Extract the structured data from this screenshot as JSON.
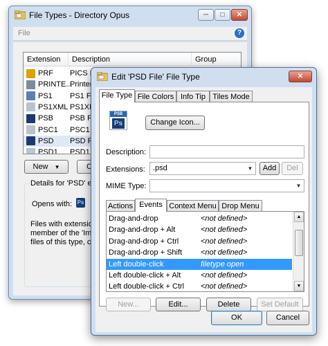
{
  "back_window": {
    "title": "File Types - Directory Opus",
    "menu": {
      "file": "File"
    },
    "list": {
      "headers": [
        "Extension",
        "Description",
        "Group"
      ],
      "rows": [
        {
          "ext": "PRF",
          "desc": "PICS R",
          "icon": "key-icon",
          "color": "#d9a400"
        },
        {
          "ext": "PRINTE...",
          "desc": "Printer",
          "icon": "printer-icon",
          "color": "#7a8ca0"
        },
        {
          "ext": "PS1",
          "desc": "PS1 Fil",
          "icon": "script-icon",
          "color": "#5e7fb0"
        },
        {
          "ext": "PS1XML",
          "desc": "PS1XM",
          "icon": "document-icon",
          "color": "#b9c4d2"
        },
        {
          "ext": "PSB",
          "desc": "PSB Fil",
          "icon": "photoshop-icon",
          "color": "#1d3a6e"
        },
        {
          "ext": "PSC1",
          "desc": "PSC1 F",
          "icon": "document-icon",
          "color": "#b9c4d2"
        },
        {
          "ext": "PSD",
          "desc": "PSD Fil",
          "icon": "photoshop-icon",
          "color": "#1d3a6e"
        },
        {
          "ext": "PSD1",
          "desc": "PSD1 Fi",
          "icon": "document-icon",
          "color": "#b9c4d2"
        }
      ]
    },
    "new_button": "New",
    "second_button_partial": "C",
    "details_label": "Details for 'PSD' ext",
    "opens_with_label": "Opens with:",
    "description_lines": [
      "Files with extension",
      "member of the 'Ima",
      "files of this type, cli"
    ]
  },
  "front_window": {
    "title": "Edit 'PSD File' File Type",
    "tabs": [
      "File Type",
      "File Colors",
      "Info Tip",
      "Tiles Mode"
    ],
    "psd_icon_label": "PSB",
    "psd_icon_glyph": "Ps",
    "change_icon_button": "Change Icon...",
    "description_label": "Description:",
    "description_value": "",
    "extensions_label": "Extensions:",
    "extensions_value": ".psd",
    "add_button": "Add",
    "del_button": "Del",
    "mime_label": "MIME Type:",
    "mime_value": "",
    "sub_tabs": [
      "Actions",
      "Events",
      "Context Menu",
      "Drop Menu"
    ],
    "events": [
      {
        "name": "Drag-and-drop",
        "value": "<not defined>"
      },
      {
        "name": "Drag-and-drop + Alt",
        "value": "<not defined>"
      },
      {
        "name": "Drag-and-drop + Ctrl",
        "value": "<not defined>"
      },
      {
        "name": "Drag-and-drop + Shift",
        "value": "<not defined>"
      },
      {
        "name": "Left double-click",
        "value": "filetype open",
        "selected": true
      },
      {
        "name": "Left double-click + Alt",
        "value": "<not defined>"
      },
      {
        "name": "Left double-click + Ctrl",
        "value": "<not defined>"
      }
    ],
    "event_buttons": {
      "new": "New...",
      "edit": "Edit...",
      "delete": "Delete",
      "set_default": "Set Default"
    },
    "ok_button": "OK",
    "cancel_button": "Cancel"
  },
  "colors": {
    "selection": "#3399ff",
    "window_frame": "#cfdff0",
    "help_blue": "#2a6fc9"
  }
}
